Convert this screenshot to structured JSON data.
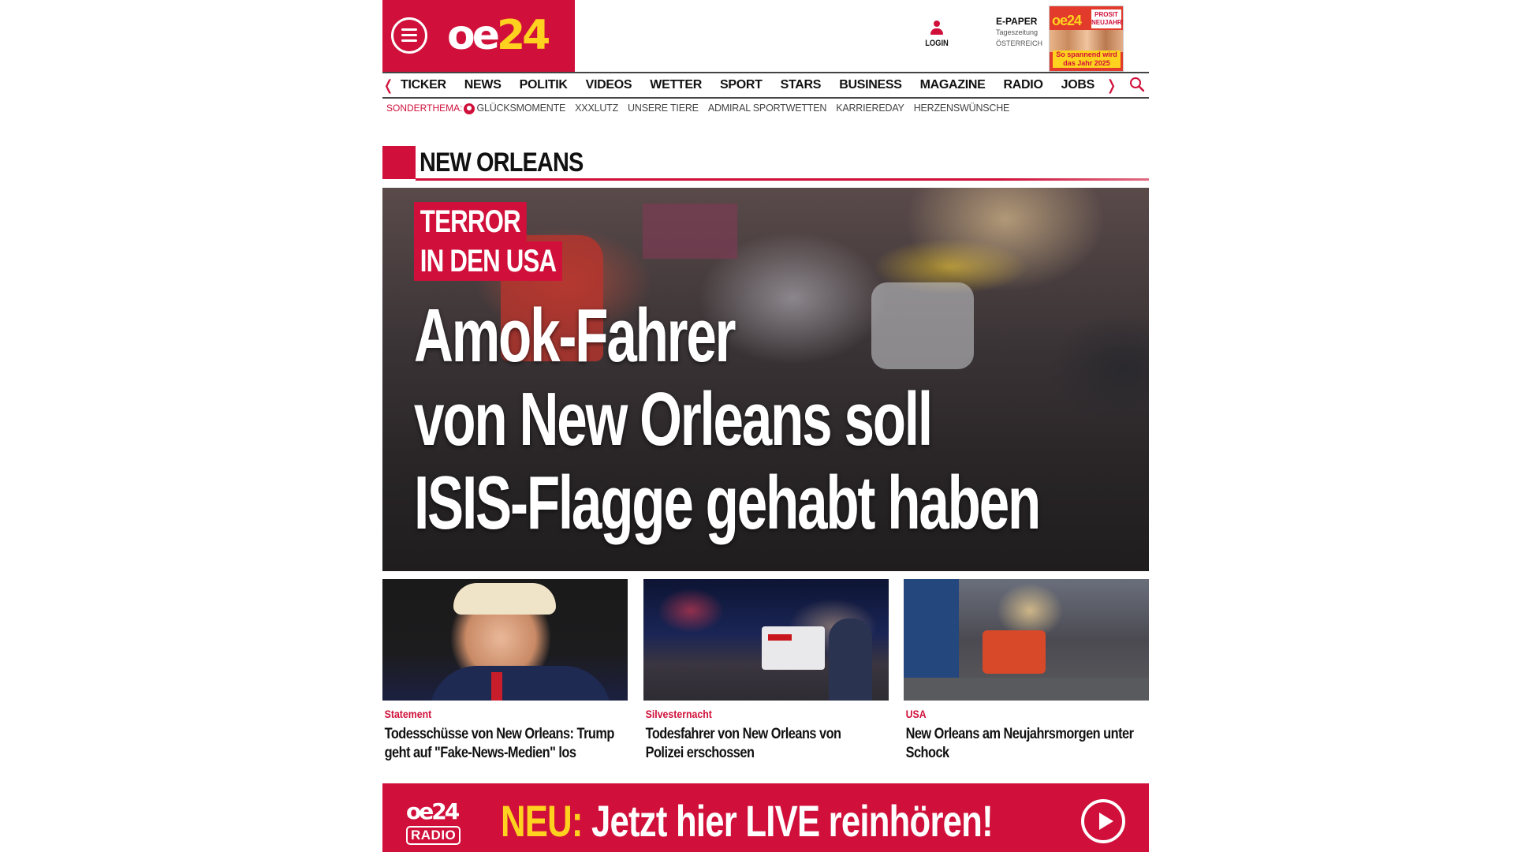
{
  "header": {
    "logo_text_a": "oe",
    "logo_text_b": "24",
    "login_label": "LOGIN",
    "epaper": {
      "title": "E-PAPER",
      "sub1": "Tageszeitung",
      "sub2": "ÖSTERREICH",
      "cover_logo": "oe24",
      "cover_stamp": "PROSIT NEUJAHR!",
      "cover_band": "So spannend wird das Jahr 2025"
    }
  },
  "nav": {
    "items": [
      "TICKER",
      "NEWS",
      "POLITIK",
      "VIDEOS",
      "WETTER",
      "SPORT",
      "STARS",
      "BUSINESS",
      "MAGAZINE",
      "RADIO",
      "JOBS"
    ],
    "left_arrow": "❬",
    "right_arrow": "❭"
  },
  "sub_nav": {
    "label": "SONDERTHEMA:",
    "items": [
      "GLÜCKSMOMENTE",
      "XXXLUTZ",
      "UNSERE TIERE",
      "ADMIRAL SPORTWETTEN",
      "KARRIEREDAY",
      "HERZENSWÜNSCHE"
    ]
  },
  "section": {
    "title": "NEW ORLEANS"
  },
  "hero": {
    "kicker_line1": "TERROR",
    "kicker_line2": "IN DEN USA",
    "headline_line1": "Amok-Fahrer",
    "headline_line2": "von New Orleans soll",
    "headline_line3": "ISIS-Flagge gehabt haben"
  },
  "cards": [
    {
      "category": "Statement",
      "title": "Todesschüsse von New Orleans: Trump geht auf \"Fake-News-Medien\" los"
    },
    {
      "category": "Silvesternacht",
      "title": "Todesfahrer von New Orleans von Polizei erschossen"
    },
    {
      "category": "USA",
      "title": "New Orleans am Neujahrsmorgen unter Schock"
    }
  ],
  "radio_banner": {
    "logo_top": "oe24",
    "logo_bottom": "RADIO",
    "highlight": "NEU:",
    "text": " Jetzt hier LIVE reinhören!"
  },
  "colors": {
    "brand_red": "#d0103a",
    "brand_yellow": "#ffd21f"
  }
}
